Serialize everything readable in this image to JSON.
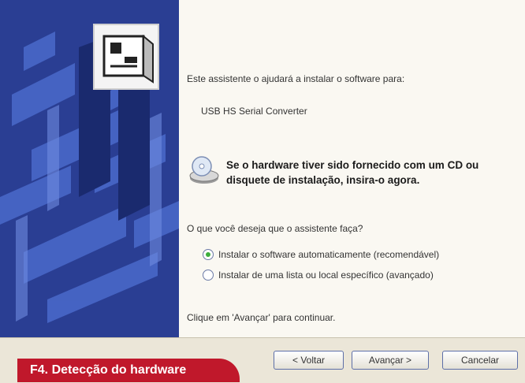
{
  "wizard": {
    "intro_text": "Este assistente o ajudará a instalar o software para:",
    "device_name": "USB HS Serial Converter",
    "cd_prompt": "Se o hardware tiver sido fornecido com um CD ou disquete de instalação, insira-o agora.",
    "question": "O que você deseja que o assistente faça?",
    "options": [
      {
        "label": "Instalar o software automaticamente (recomendável)",
        "selected": true
      },
      {
        "label": "Instalar de uma lista ou local específico (avançado)",
        "selected": false
      }
    ],
    "continue_hint": "Clique em 'Avançar' para continuar."
  },
  "buttons": {
    "back": "< Voltar",
    "next": "Avançar >",
    "cancel": "Cancelar"
  },
  "caption": "F4. Detecção do hardware",
  "colors": {
    "banner": "#2a3e93",
    "caption_bg": "#c0182b",
    "radio_selected": "#3cae3c"
  }
}
